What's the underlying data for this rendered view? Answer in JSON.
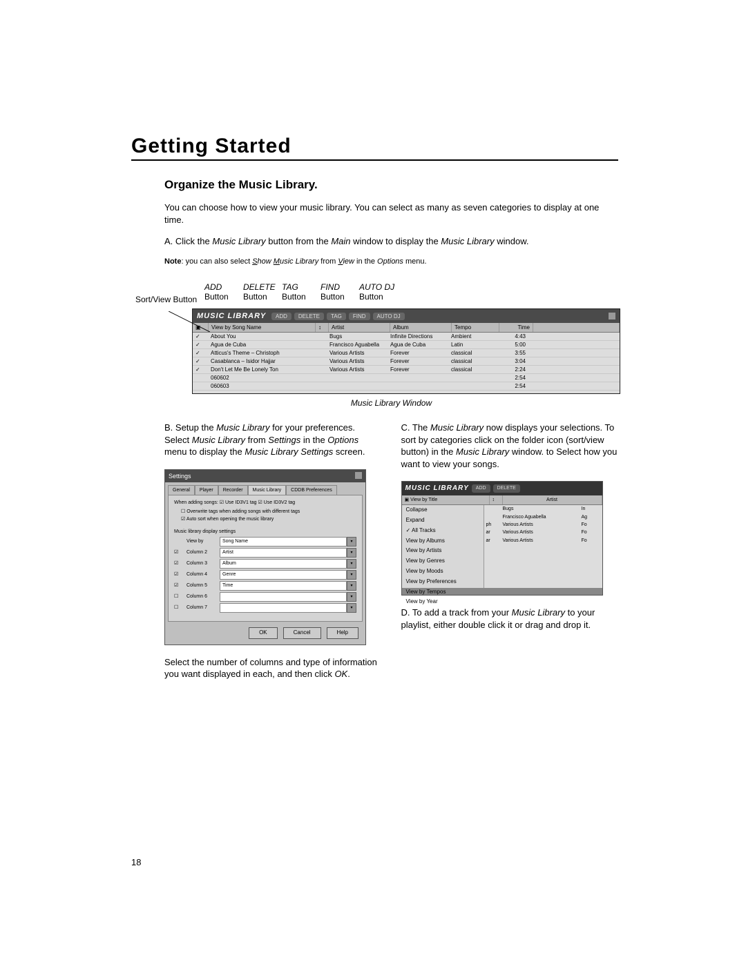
{
  "heading": "Getting Started",
  "subheading": "Organize the Music Library.",
  "intro": "You can choose how to view your music library. You can select as many as seven categories to display at one time.",
  "step_a_parts": [
    "A. Click the ",
    "Music Library",
    " button from the ",
    "Main",
    " window to display the ",
    "Music Library",
    " window."
  ],
  "note_parts": [
    "Note",
    ": you can also select ",
    "S",
    "how ",
    "M",
    "usic Library",
    " from ",
    "V",
    "iew",
    " in the ",
    "Options",
    " menu."
  ],
  "callouts": {
    "sortview": "Sort/View Button",
    "buttons": [
      {
        "label": "ADD",
        "sub": "Button"
      },
      {
        "label": "DELETE",
        "sub": "Button"
      },
      {
        "label": "TAG",
        "sub": "Button"
      },
      {
        "label": "FIND",
        "sub": "Button"
      },
      {
        "label": "AUTO DJ",
        "sub": "Button"
      }
    ]
  },
  "mlw": {
    "title": "MUSIC LIBRARY",
    "header_buttons": [
      "ADD",
      "DELETE",
      "TAG",
      "FIND",
      "AUTO DJ"
    ],
    "colhead": {
      "view": "View by Song Name",
      "artist": "Artist",
      "album": "Album",
      "tempo": "Tempo",
      "time": "Time"
    },
    "rows": [
      {
        "chk": "✓",
        "title": "About You",
        "artist": "Bugs",
        "album": "Infinite Directions",
        "tempo": "Ambient",
        "time": "4:43"
      },
      {
        "chk": "✓",
        "title": "Agua de Cuba",
        "artist": "Francisco Aguabella",
        "album": "Agua de Cuba",
        "tempo": "Latin",
        "time": "5:00"
      },
      {
        "chk": "✓",
        "title": "Atticus's Theme – Christoph",
        "artist": "Various Artists",
        "album": "Forever",
        "tempo": "classical",
        "time": "3:55"
      },
      {
        "chk": "✓",
        "title": "Casablanca – Isidor Hajjar",
        "artist": "Various Artists",
        "album": "Forever",
        "tempo": "classical",
        "time": "3:04"
      },
      {
        "chk": "✓",
        "title": "Don't Let Me Be Lonely Ton",
        "artist": "Various Artists",
        "album": "Forever",
        "tempo": "classical",
        "time": "2:24"
      },
      {
        "chk": "",
        "title": "060602",
        "artist": "",
        "album": "",
        "tempo": "",
        "time": "2:54"
      },
      {
        "chk": "",
        "title": "060603",
        "artist": "",
        "album": "",
        "tempo": "",
        "time": "2:54"
      }
    ]
  },
  "mlw_caption": "Music Library Window",
  "step_b_parts": [
    "B. Setup the ",
    "Music Library",
    " for your preferences. Select ",
    "Music Library",
    " from ",
    "Settings",
    " in the ",
    "Options",
    " menu to display the ",
    "Music Library Settings",
    " screen."
  ],
  "settings": {
    "title": "Settings",
    "tabs": [
      "General",
      "Player",
      "Recorder",
      "Music Library",
      "CDDB Preferences"
    ],
    "active_tab": 3,
    "top_line": "When adding songs:    ☑ Use ID3V1 tag   ☑ Use ID3V2 tag",
    "chk1": "Overwrite tags when adding songs with different tags",
    "chk2": "Auto sort when opening the music library",
    "section": "Music library display settings",
    "rows": [
      {
        "chk": "",
        "label": "View by",
        "value": "Song Name"
      },
      {
        "chk": "☑",
        "label": "Column 2",
        "value": "Artist"
      },
      {
        "chk": "☑",
        "label": "Column 3",
        "value": "Album"
      },
      {
        "chk": "☑",
        "label": "Column 4",
        "value": "Genre"
      },
      {
        "chk": "☑",
        "label": "Column 5",
        "value": "Time"
      },
      {
        "chk": "☐",
        "label": "Column 6",
        "value": ""
      },
      {
        "chk": "☐",
        "label": "Column 7",
        "value": ""
      }
    ],
    "buttons": [
      "OK",
      "Cancel",
      "Help"
    ]
  },
  "step_b_tail": [
    "Select the number of columns and type of information you want displayed in each, and then click ",
    "OK",
    "."
  ],
  "step_c_parts": [
    "C. The ",
    "Music Library",
    " now displays your selections. To sort by categories click on the folder icon (sort/view button) in the ",
    "Music Library",
    " window. to Select how you want to view your songs."
  ],
  "sort_panel": {
    "title": "MUSIC LIBRARY",
    "header_buttons": [
      "ADD",
      "DELETE"
    ],
    "colhead": {
      "view": "View by Title",
      "artist": "Artist"
    },
    "menu": [
      "Collapse",
      "Expand",
      "All Tracks",
      "View by Albums",
      "View by Artists",
      "View by Genres",
      "View by Moods",
      "View by Preferences",
      "View by Tempos",
      "View by Year"
    ],
    "menu_checked": 2,
    "list": [
      {
        "t": "",
        "artist": "Bugs",
        "r": "In"
      },
      {
        "t": "",
        "artist": "Francisco Aguabella",
        "r": "Ag"
      },
      {
        "t": "ph",
        "artist": "Various Artists",
        "r": "Fo"
      },
      {
        "t": "ar",
        "artist": "Various Artists",
        "r": "Fo"
      },
      {
        "t": "ar",
        "artist": "Various Artists",
        "r": "Fo"
      }
    ]
  },
  "step_d_parts": [
    "D. To add a track from your ",
    "Music Library",
    " to your playlist, either double click it or drag and drop it."
  ],
  "page_number": "18"
}
